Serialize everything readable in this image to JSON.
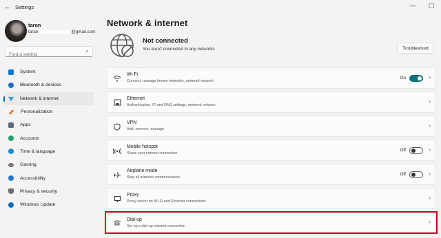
{
  "window": {
    "title": "Settings",
    "back": "←",
    "minimize": "—",
    "maximize": "▢"
  },
  "user": {
    "name": "taran",
    "email_prefix": "taran",
    "email_suffix": "@gmail.com"
  },
  "search": {
    "placeholder": "Find a setting"
  },
  "sidebar": {
    "items": [
      {
        "label": "System",
        "color": "#0078d4"
      },
      {
        "label": "Bluetooth & devices",
        "color": "#1a6fc9"
      },
      {
        "label": "Network & internet",
        "color": "#2aa0df",
        "active": true
      },
      {
        "label": "Personalization",
        "color": "#e07a2e"
      },
      {
        "label": "Apps",
        "color": "#5f6b7a"
      },
      {
        "label": "Accounts",
        "color": "#20a36b"
      },
      {
        "label": "Time & language",
        "color": "#1b8fc7"
      },
      {
        "label": "Gaming",
        "color": "#7b7b7b"
      },
      {
        "label": "Accessibility",
        "color": "#1f7ad1"
      },
      {
        "label": "Privacy & security",
        "color": "#6d6d6d"
      },
      {
        "label": "Windows Update",
        "color": "#0f6cbd"
      }
    ]
  },
  "main": {
    "title": "Network & internet",
    "status": {
      "title": "Not connected",
      "subtitle": "You aren't connected to any networks"
    },
    "troubleshoot_label": "Troubleshoot",
    "cards": [
      {
        "title": "Wi-Fi",
        "subtitle": "Connect, manage known networks, metered network",
        "icon": "wifi-icon",
        "toggle": "On"
      },
      {
        "title": "Ethernet",
        "subtitle": "Authentication, IP and DNS settings, metered network",
        "icon": "ethernet-icon"
      },
      {
        "title": "VPN",
        "subtitle": "Add, connect, manage",
        "icon": "shield-icon"
      },
      {
        "title": "Mobile hotspot",
        "subtitle": "Share your internet connection",
        "icon": "hotspot-icon",
        "toggle": "Off"
      },
      {
        "title": "Airplane mode",
        "subtitle": "Stop all wireless communication",
        "icon": "airplane-icon",
        "toggle": "Off"
      },
      {
        "title": "Proxy",
        "subtitle": "Proxy server for Wi-Fi and Ethernet connections",
        "icon": "proxy-icon"
      },
      {
        "title": "Dial-up",
        "subtitle": "Set up a dial-up internet connection",
        "icon": "dialup-icon"
      }
    ]
  },
  "colors": {
    "accent": "#0067c0",
    "toggle_on": "#0f6e7f",
    "highlight": "#d0021b"
  }
}
